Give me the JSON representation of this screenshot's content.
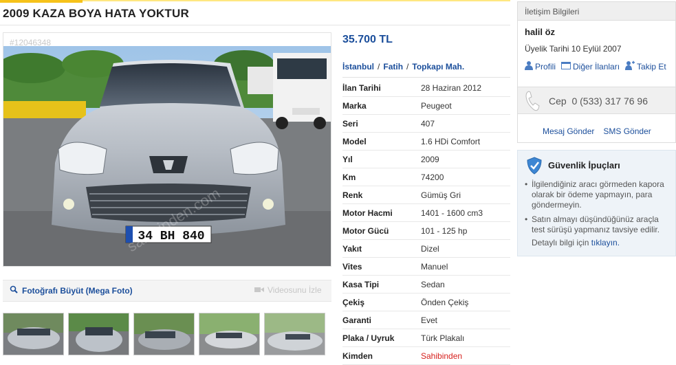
{
  "listing": {
    "title": "2009 KAZA BOYA HATA YOKTUR",
    "ad_id": "#12046348",
    "price": "35.700 TL",
    "location": [
      "İstanbul",
      "Fatih",
      "Topkapı Mah."
    ],
    "location_sep": "/"
  },
  "photo": {
    "plate": "34 BH 840",
    "watermark": "sahibinden.com",
    "mega_foto_label": "Fotoğrafı Büyüt (Mega Foto)",
    "video_label": "Videosunu İzle",
    "thumb_count": 5
  },
  "details": [
    {
      "k": "İlan Tarihi",
      "v": "28 Haziran 2012"
    },
    {
      "k": "Marka",
      "v": "Peugeot"
    },
    {
      "k": "Seri",
      "v": "407"
    },
    {
      "k": "Model",
      "v": "1.6 HDi Comfort"
    },
    {
      "k": "Yıl",
      "v": "2009"
    },
    {
      "k": "Km",
      "v": "74200"
    },
    {
      "k": "Renk",
      "v": "Gümüş Gri"
    },
    {
      "k": "Motor Hacmi",
      "v": "1401 - 1600 cm3"
    },
    {
      "k": "Motor Gücü",
      "v": "101 - 125 hp"
    },
    {
      "k": "Yakıt",
      "v": "Dizel"
    },
    {
      "k": "Vites",
      "v": "Manuel"
    },
    {
      "k": "Kasa Tipi",
      "v": "Sedan"
    },
    {
      "k": "Çekiş",
      "v": "Önden Çekiş"
    },
    {
      "k": "Garanti",
      "v": "Evet"
    },
    {
      "k": "Plaka / Uyruk",
      "v": "Türk Plakalı"
    },
    {
      "k": "Kimden",
      "v": "Sahibinden",
      "highlight": true
    }
  ],
  "contact": {
    "header": "İletişim Bilgileri",
    "seller_name": "halil öz",
    "member_since": "Üyelik Tarihi 10 Eylül 2007",
    "links": [
      "Profili",
      "Diğer İlanları",
      "Takip Et"
    ],
    "phone_label": "Cep",
    "phone_number": "0 (533) 317 76 96",
    "message_link": "Mesaj Gönder",
    "sms_link": "SMS Gönder"
  },
  "safety": {
    "title": "Güvenlik İpuçları",
    "tips": [
      "İlgilendiğiniz aracı görmeden kapora olarak bir ödeme yapmayın, para göndermeyin.",
      "Satın almayı düşündüğünüz araçla test sürüşü yapmanız tavsiye edilir."
    ],
    "more_prefix": "Detaylı bilgi için",
    "more_link": "tıklayın."
  },
  "colors": {
    "accent": "#f6c21a",
    "link": "#1b4e9b",
    "highlight": "#d6201d"
  }
}
